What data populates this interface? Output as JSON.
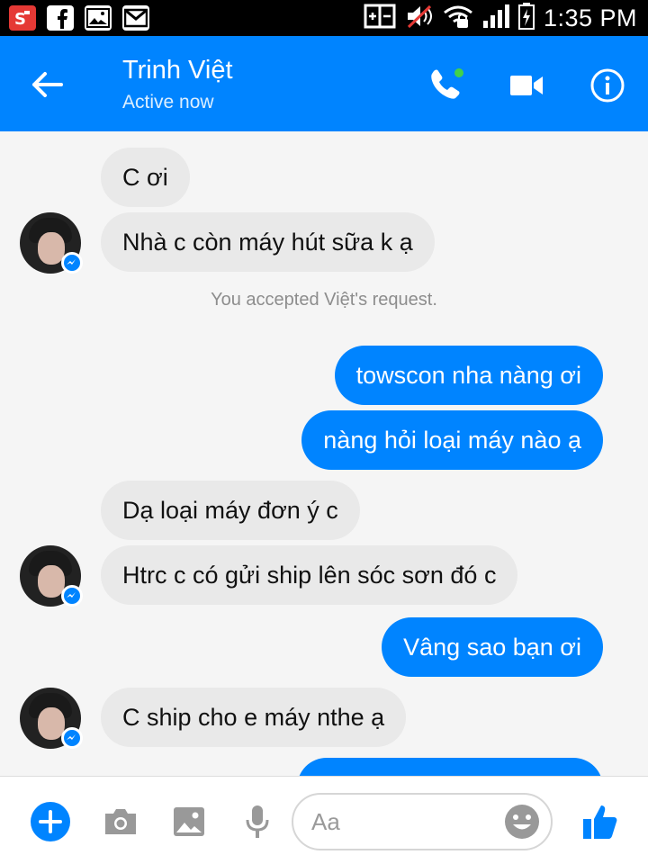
{
  "status_bar": {
    "time": "1:35 PM",
    "icons": [
      "sms-app-icon",
      "facebook-icon",
      "gallery-icon",
      "gmail-icon",
      "screen-mirror-icon",
      "mute-icon",
      "wifi-icon",
      "signal-icon",
      "battery-charging-icon"
    ]
  },
  "header": {
    "contact_name": "Trinh Việt",
    "status": "Active now",
    "icons": [
      "back-arrow-icon",
      "phone-call-icon",
      "video-call-icon",
      "info-icon"
    ]
  },
  "messages": [
    {
      "side": "in",
      "text": "C ơi"
    },
    {
      "side": "in",
      "text": "Nhà c còn máy hút sữa k ạ"
    },
    {
      "side": "system",
      "text": "You accepted Việt's request."
    },
    {
      "side": "out",
      "text": "towscon nha nàng ơi"
    },
    {
      "side": "out",
      "text": "nàng hỏi loại máy nào ạ"
    },
    {
      "side": "in",
      "text": "Dạ loại máy đơn ý c"
    },
    {
      "side": "in",
      "text": "Htrc c có gửi ship lên sóc sơn đó c"
    },
    {
      "side": "out",
      "text": "Vâng sao bạn ơi"
    },
    {
      "side": "in",
      "text": "C ship cho e máy nthe ạ"
    }
  ],
  "composer": {
    "placeholder": "Aa",
    "icons": [
      "add-icon",
      "camera-icon",
      "image-icon",
      "microphone-icon",
      "emoji-icon",
      "thumbs-up-icon"
    ]
  },
  "colors": {
    "brand": "#0084ff",
    "incoming_bubble": "#e9e9e9",
    "chat_background": "#f5f5f5",
    "status_bar": "#000000"
  }
}
